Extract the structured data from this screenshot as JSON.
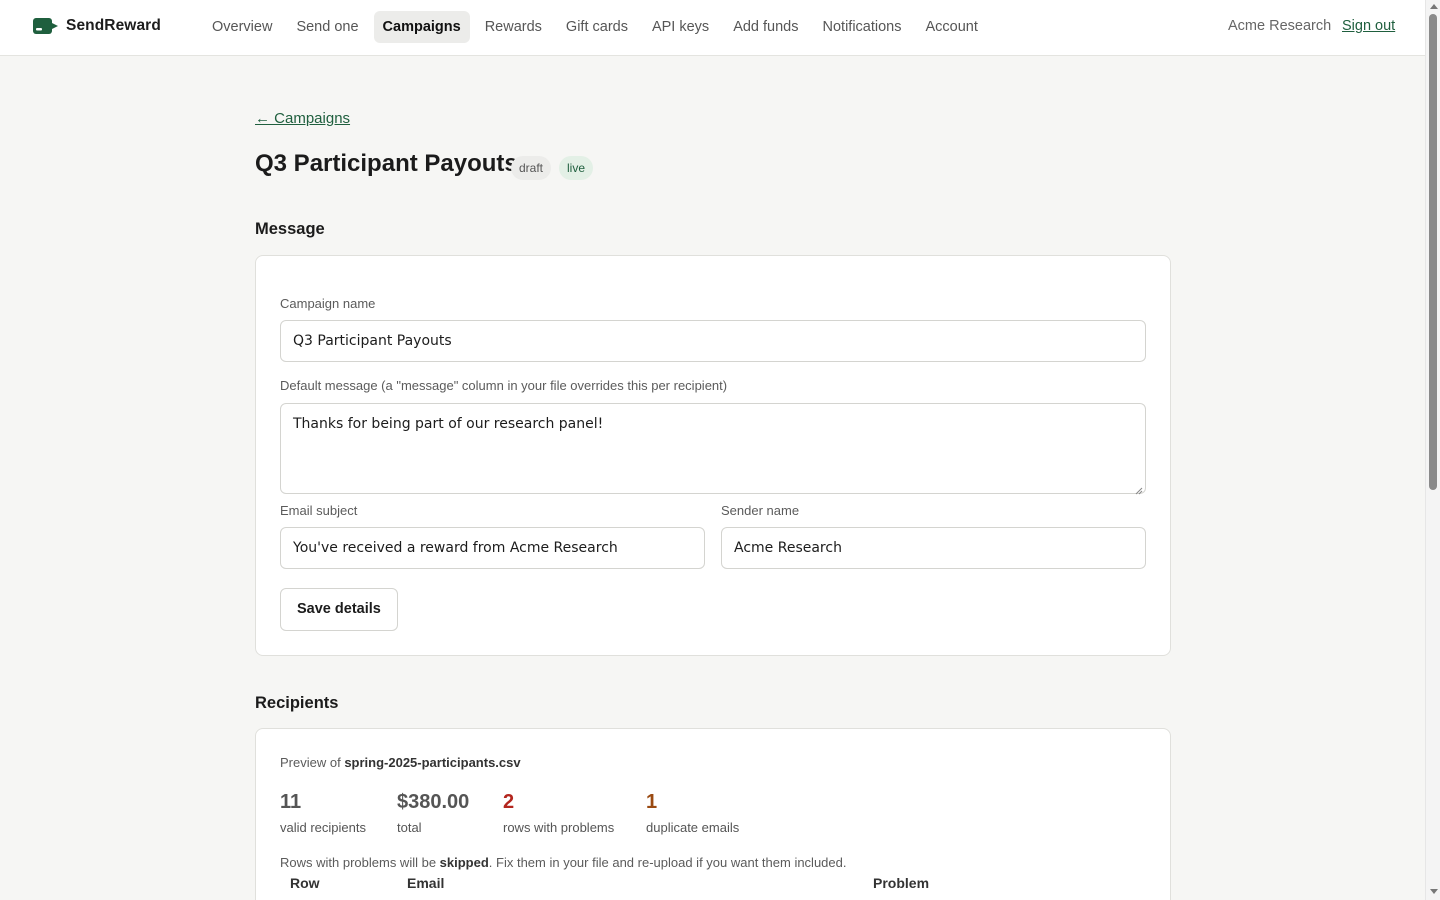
{
  "brand": {
    "name": "SendReward"
  },
  "nav": {
    "items": [
      "Overview",
      "Send one",
      "Campaigns",
      "Rewards",
      "Gift cards",
      "API keys",
      "Add funds",
      "Notifications",
      "Account"
    ],
    "active": "Campaigns"
  },
  "header": {
    "org_name": "Acme Research",
    "sign_out": "Sign out"
  },
  "back_link": "← Campaigns",
  "campaign": {
    "title": "Q3 Participant Payouts",
    "badges": [
      "draft",
      "live"
    ]
  },
  "message_section": {
    "title": "Message",
    "campaign_name_label": "Campaign name",
    "campaign_name_value": "Q3 Participant Payouts",
    "default_message_label": "Default message (a \"message\" column in your file overrides this per recipient)",
    "default_message_value": "Thanks for being part of our research panel!",
    "email_subject_label": "Email subject",
    "email_subject_value": "You've received a reward from Acme Research",
    "sender_name_label": "Sender name",
    "sender_name_value": "Acme Research",
    "save_button": "Save details"
  },
  "recipients_section": {
    "title": "Recipients",
    "preview_prefix": "Preview of ",
    "file_name": "spring-2025-participants.csv",
    "stats": [
      {
        "value": "11",
        "label": "valid recipients",
        "tone": "neutral"
      },
      {
        "value": "$380.00",
        "label": "total",
        "tone": "neutral"
      },
      {
        "value": "2",
        "label": "rows with problems",
        "tone": "error"
      },
      {
        "value": "1",
        "label": "duplicate emails",
        "tone": "warning"
      }
    ],
    "note_prefix": "Rows with problems will be ",
    "note_bold": "skipped",
    "note_suffix": ". Fix them in your file and re-upload if you want them included.",
    "table_headers": [
      "Row",
      "Email",
      "Problem"
    ]
  },
  "colors": {
    "accent": "#1f5f3e",
    "error": "#b3261e",
    "warning": "#9a4a12",
    "page_bg": "#f6f6f4"
  },
  "icons": {
    "brand": "send-reward-logo-icon"
  }
}
